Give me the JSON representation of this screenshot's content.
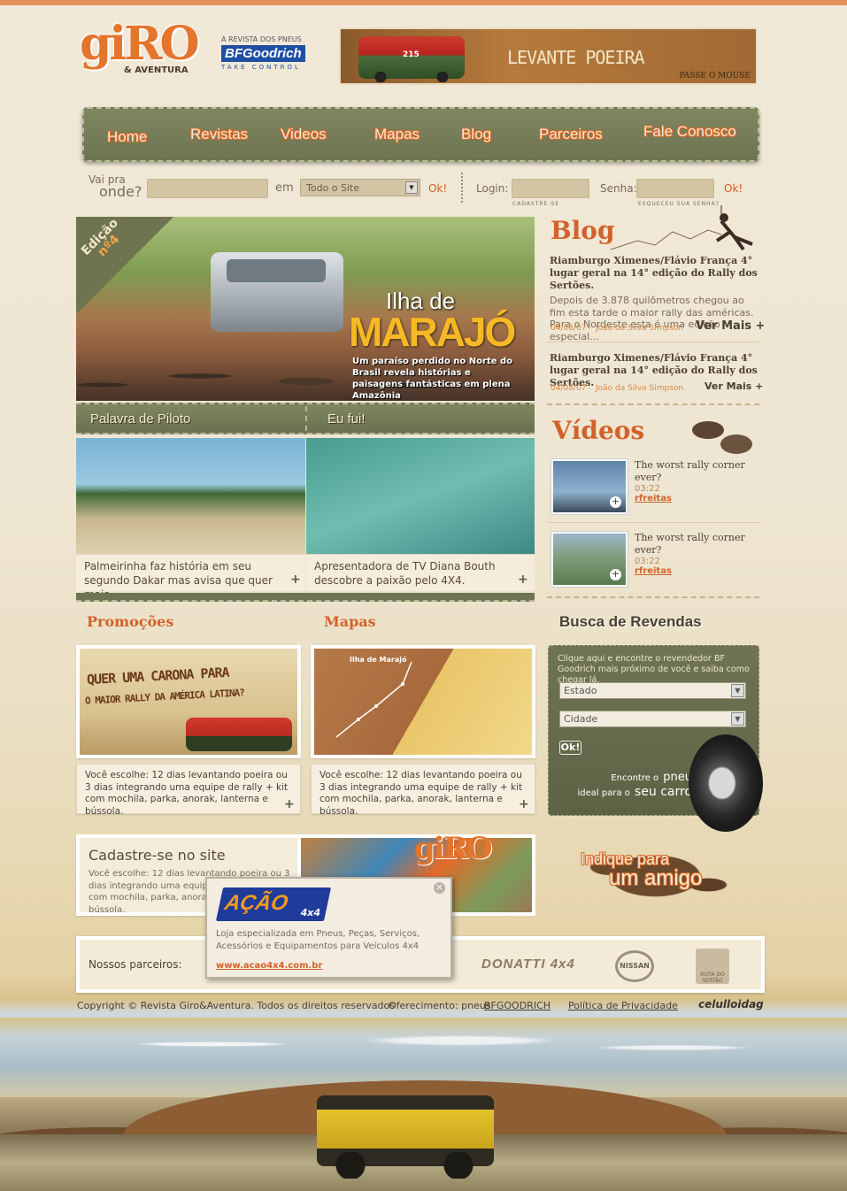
{
  "brand": {
    "logo": "giRO",
    "logo_sub": "& AVENTURA",
    "bfg_top": "A REVISTA DOS PNEUS",
    "bfg_brand": "BFGoodrich",
    "bfg_sub": "TAKE CONTROL"
  },
  "banner": {
    "title": "LEVANTE POEIRA",
    "hint": "PASSE O MOUSE",
    "car_number": "215"
  },
  "nav": [
    "Home",
    "Revistas",
    "Videos",
    "Mapas",
    "Blog",
    "Parceiros",
    "Fale Conosco"
  ],
  "search": {
    "label_top": "Vai pra",
    "label_bottom": "onde?",
    "in_label": "em",
    "scope_value": "Todo o Site",
    "ok": "Ok!"
  },
  "login": {
    "login_label": "Login:",
    "register": "CADASTRE-SE",
    "password_label": "Senha:",
    "forgot": "ESQUECEU SUA SENHA?",
    "ok": "Ok!"
  },
  "hero": {
    "edition_label": "Edição",
    "edition_num": "nº4",
    "title_line1": "Ilha de",
    "title_line2": "MARAJÓ",
    "description": "Um paraíso perdido no Norte do Brasil revela histórias e paisagens fantásticas em plena Amazônia"
  },
  "sections": {
    "left_bar": "Palavra de Piloto",
    "right_bar": "Eu fui!"
  },
  "tiles": [
    {
      "caption": "Palmeirinha faz história em seu segundo Dakar mas avisa que quer mais."
    },
    {
      "caption": "Apresentadora de TV Diana Bouth descobre a paixão pelo 4X4."
    }
  ],
  "blog": {
    "heading": "Blog",
    "items": [
      {
        "title": "Riamburgo Ximenes/Flávio França 4° lugar geral na 14° edição do Rally dos Sertões.",
        "text": "Depois de 3.878 quilômetros chegou ao fim esta tarde o maior rally das américas. Para o Nordeste esta é uma edição especial...",
        "date": "04/08/07",
        "author": "João da Silva Simpson",
        "more": "Ver Mais +"
      },
      {
        "title": "Riamburgo Ximenes/Flávio França 4° lugar geral na 14° edição do Rally dos Sertões.",
        "date": "04/08/07",
        "author": "João da Silva Simpson",
        "more": "Ver Mais +"
      }
    ]
  },
  "videos": {
    "heading": "Vídeos",
    "items": [
      {
        "title": "The worst rally corner ever?",
        "time": "03:22",
        "user": "rfreitas"
      },
      {
        "title": "The worst rally corner ever?",
        "time": "03:22",
        "user": "rfreitas"
      }
    ]
  },
  "promocoes": {
    "heading": "Promoções",
    "banner_line1": "QUER UMA CARONA PARA",
    "banner_line2": "O MAIOR RALLY DA AMÉRICA LATINA?",
    "text": "Você escolhe: 12 dias levantando poeira ou 3 dias integrando uma equipe de rally + kit com mochila, parka, anorak, lanterna e bússola."
  },
  "mapas": {
    "heading": "Mapas",
    "map_label": "Ilha de Marajó",
    "text": "Você escolhe: 12 dias levantando poeira ou 3 dias integrando uma equipe de rally + kit com mochila, parka, anorak, lanterna e bússola."
  },
  "revendas": {
    "heading": "Busca de Revendas",
    "intro": "Clique aqui e encontre o revendedor BF Goodrich mais próximo de você e saiba como chegar lá.",
    "estado": "Estado",
    "cidade": "Cidade",
    "ok": "Ok!",
    "tag_small1": "Encontre o",
    "tag_big1": "pneu",
    "tag_small2": "ideal para o",
    "tag_big2": "seu carro"
  },
  "cadastro": {
    "heading": "Cadastre-se no site",
    "text": "Você escolhe: 12 dias levantando poeira ou 3 dias integrando uma equipe de rally + kit com mochila, parka, anorak, lanterna e bússola."
  },
  "indique": {
    "line1": "Indique para",
    "line2": "um amigo"
  },
  "popup": {
    "brand": "AÇÃO",
    "brand_sub": "4x4",
    "text": "Loja especializada em Pneus, Peças, Serviços, Acessórios e Equipamentos para Veículos 4x4",
    "link": "www.acao4x4.com.br",
    "close": "×"
  },
  "partners": {
    "label": "Nossos parceiros:",
    "logos": [
      "DONATTI 4x4",
      "NISSAN",
      "ROTA DO SERTÃO"
    ]
  },
  "footer": {
    "copyright": "Copyright © Revista Giro&Aventura. Todos os direitos reservados",
    "offer_prefix": "Oferecimento: pneus",
    "offer_brand": "BFGOODRICH",
    "privacy": "Política de Privacidade",
    "agency": "celulloidag"
  },
  "colors": {
    "accent": "#d2622a",
    "olive": "#6d7450",
    "cream": "#f3ebd8"
  }
}
